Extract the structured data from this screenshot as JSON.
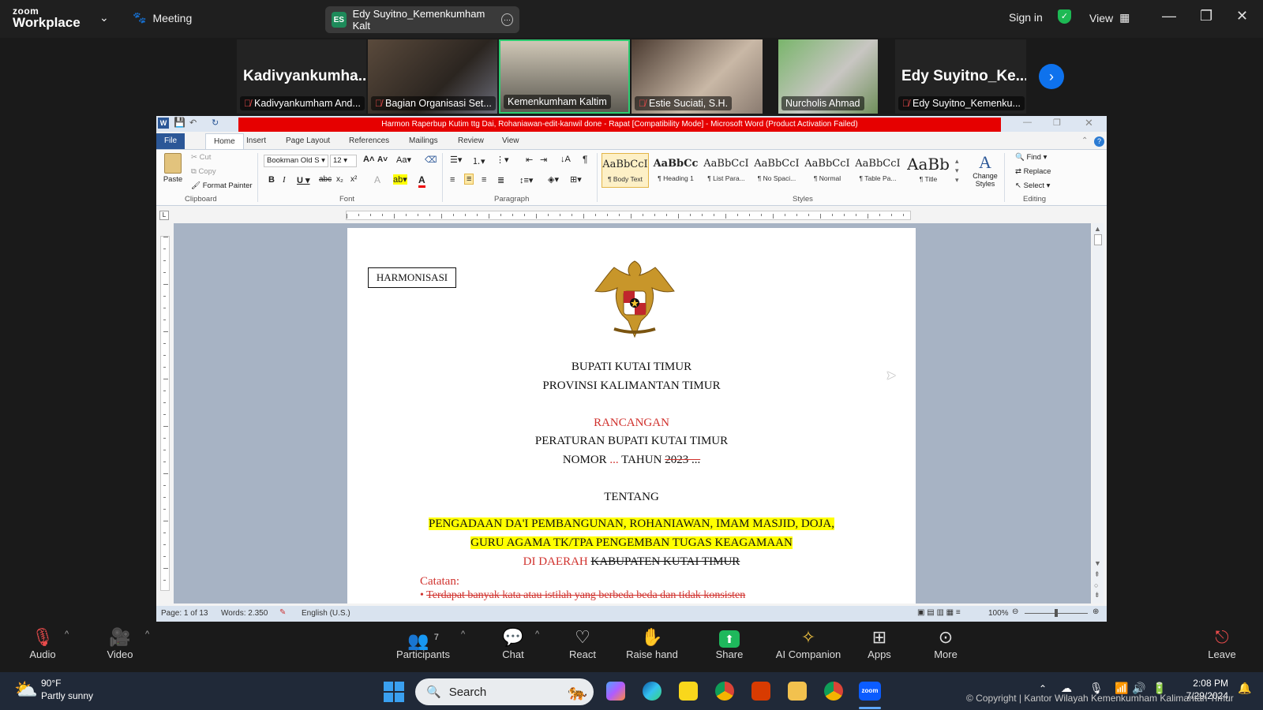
{
  "zoom": {
    "logo_top": "zoom",
    "logo_bottom": "Workplace",
    "meeting_label": "Meeting",
    "active_speaker_initials": "ES",
    "active_speaker": "Edy Suyitno_Kemenkumham Kalt",
    "sign_in": "Sign in",
    "view_label": "View"
  },
  "participants": [
    {
      "big": "Kadivyankumha...",
      "name": "Kadivyankumham And..."
    },
    {
      "big": "",
      "name": "Bagian Organisasi Set..."
    },
    {
      "big": "",
      "name": "Kemenkumham Kaltim"
    },
    {
      "big": "",
      "name": "Estie Suciati, S.H."
    },
    {
      "big": "",
      "name": "Nurcholis Ahmad"
    },
    {
      "big": "Edy  Suyitno_Ke...",
      "name": "Edy Suyitno_Kemenku..."
    }
  ],
  "word": {
    "title": "Harmon Raperbup Kutim ttg Dai, Rohaniawan-edit-kanwil done - Rapat [Compatibility Mode] - Microsoft Word (Product Activation Failed)",
    "tabs": [
      "File",
      "Home",
      "Insert",
      "Page Layout",
      "References",
      "Mailings",
      "Review",
      "View"
    ],
    "clipboard": {
      "paste": "Paste",
      "cut": "Cut",
      "copy": "Copy",
      "format_painter": "Format Painter",
      "label": "Clipboard"
    },
    "font": {
      "name": "Bookman Old S",
      "size": "12",
      "label": "Font"
    },
    "paragraph_label": "Paragraph",
    "styles": [
      {
        "preview": "AaBbCcI",
        "name": "¶ Body Text"
      },
      {
        "preview": "AaBbCc",
        "name": "¶ Heading 1"
      },
      {
        "preview": "AaBbCcI",
        "name": "¶ List Para..."
      },
      {
        "preview": "AaBbCcI",
        "name": "¶ No Spaci..."
      },
      {
        "preview": "AaBbCcI",
        "name": "¶ Normal"
      },
      {
        "preview": "AaBbCcI",
        "name": "¶ Table Pa..."
      },
      {
        "preview": "AaBb",
        "name": "¶ Title"
      }
    ],
    "styles_label": "Styles",
    "change_styles": "Change Styles",
    "editing": {
      "find": "Find",
      "replace": "Replace",
      "select": "Select",
      "label": "Editing"
    },
    "status": {
      "page": "Page: 1 of 13",
      "words": "Words: 2.350",
      "lang": "English (U.S.)",
      "zoom": "100%"
    }
  },
  "doc": {
    "box": "HARMONISASI",
    "line1": "BUPATI KUTAI TIMUR",
    "line2": "PROVINSI KALIMANTAN TIMUR",
    "rancangan": "RANCANGAN",
    "line3": "PERATURAN BUPATI KUTAI TIMUR",
    "nomor_a": "NOMOR ",
    "nomor_b": "...",
    "nomor_c": " TAHUN ",
    "nomor_d": "2023 ...",
    "tentang": "TENTANG",
    "subj1": "PENGADAAN DA'I PEMBANGUNAN, ROHANIAWAN, IMAM MASJID, DOJA,",
    "subj2": "GURU AGAMA TK/TPA PENGEMBAN TUGAS KEAGAMAAN",
    "subj3a": "DI DAERAH ",
    "subj3b": "KABUPATEN KUTAI TIMUR",
    "catatan": "Catatan:",
    "bullet": "Terdapat banyak kata atau istilah yang berbeda beda dan tidak konsisten"
  },
  "controls": [
    {
      "label": "Audio",
      "icon": "mic-off-icon"
    },
    {
      "label": "Video",
      "icon": "video-off-icon"
    },
    {
      "label": "Participants",
      "count": "7",
      "icon": "participants-icon"
    },
    {
      "label": "Chat",
      "icon": "chat-icon"
    },
    {
      "label": "React",
      "icon": "heart-icon"
    },
    {
      "label": "Raise hand",
      "icon": "hand-icon"
    },
    {
      "label": "Share",
      "icon": "share-icon"
    },
    {
      "label": "AI Companion",
      "icon": "sparkle-icon"
    },
    {
      "label": "Apps",
      "icon": "apps-icon"
    },
    {
      "label": "More",
      "icon": "more-icon"
    },
    {
      "label": "Leave",
      "icon": "leave-icon"
    }
  ],
  "taskbar": {
    "temp": "90°F",
    "weather": "Partly sunny",
    "search": "Search",
    "time": "2:08 PM",
    "date": "7/29/2024",
    "copyright": "© Copyright | Kantor Wilayah Kemenkumham Kalimantan Timur"
  }
}
